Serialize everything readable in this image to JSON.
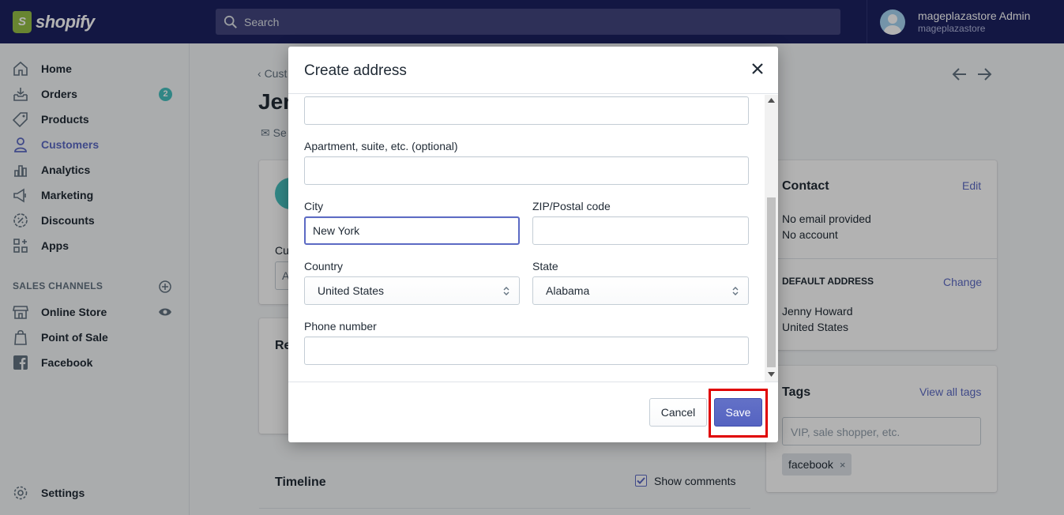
{
  "topbar": {
    "brand": "shopify",
    "search_placeholder": "Search",
    "user_name": "mageplazastore Admin",
    "user_store": "mageplazastore"
  },
  "sidebar": {
    "items": [
      {
        "label": "Home",
        "icon": "home-icon"
      },
      {
        "label": "Orders",
        "icon": "orders-icon",
        "badge": "2"
      },
      {
        "label": "Products",
        "icon": "tag-icon"
      },
      {
        "label": "Customers",
        "icon": "person-icon",
        "active": true
      },
      {
        "label": "Analytics",
        "icon": "bar-chart-icon"
      },
      {
        "label": "Marketing",
        "icon": "megaphone-icon"
      },
      {
        "label": "Discounts",
        "icon": "discount-icon"
      },
      {
        "label": "Apps",
        "icon": "apps-icon"
      }
    ],
    "channels_title": "SALES CHANNELS",
    "channels": [
      {
        "label": "Online Store",
        "icon": "store-icon"
      },
      {
        "label": "Point of Sale",
        "icon": "shopify-bag-icon"
      },
      {
        "label": "Facebook",
        "icon": "facebook-icon"
      }
    ],
    "settings_label": "Settings"
  },
  "page": {
    "breadcrumb": "Cust",
    "title_partial": "Jen",
    "send_partial": "Se",
    "customer_note_partial": "Cu",
    "customer_note_input_partial": "A",
    "recent_orders_partial": "Re",
    "timeline_title": "Timeline",
    "show_comments_label": "Show comments",
    "contact": {
      "title": "Contact",
      "edit": "Edit",
      "email": "No email provided",
      "account": "No account"
    },
    "default_address": {
      "title": "DEFAULT ADDRESS",
      "change": "Change",
      "name": "Jenny Howard",
      "country": "United States"
    },
    "tags": {
      "title": "Tags",
      "view_all": "View all tags",
      "placeholder": "VIP, sale shopper, etc.",
      "tag": "facebook"
    }
  },
  "modal": {
    "title": "Create address",
    "address_value": "",
    "apartment_label": "Apartment, suite, etc. (optional)",
    "apartment_value": "",
    "city_label": "City",
    "city_value": "New York",
    "zip_label": "ZIP/Postal code",
    "zip_value": "",
    "country_label": "Country",
    "country_value": "United States",
    "state_label": "State",
    "state_value": "Alabama",
    "phone_label": "Phone number",
    "phone_value": "",
    "cancel_label": "Cancel",
    "save_label": "Save"
  },
  "colors": {
    "topbar": "#1c2260",
    "accent": "#5c6ac4",
    "highlight": "#e00000",
    "badge": "#47c1bf"
  }
}
